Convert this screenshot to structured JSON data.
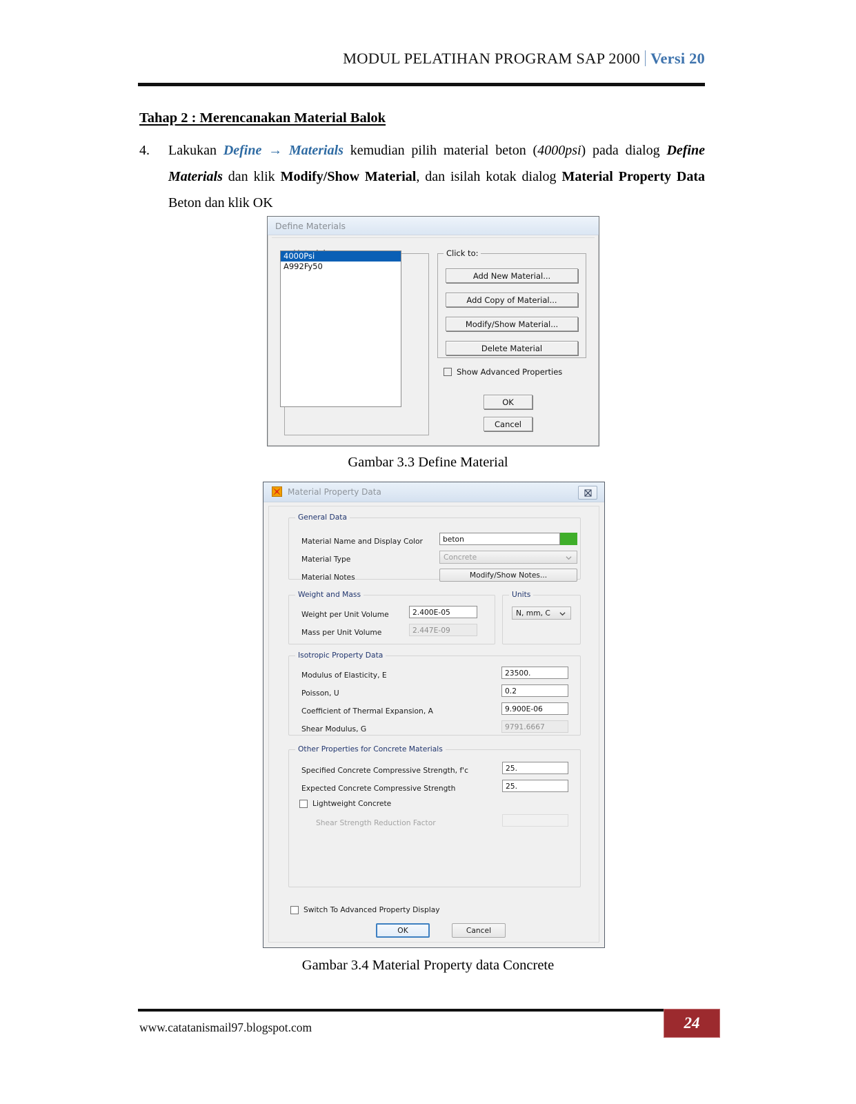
{
  "header": {
    "title": "MODUL PELATIHAN PROGRAM SAP 2000",
    "version": "Versi 20"
  },
  "body": {
    "section_heading": "Tahap 2 : Merencanakan Material Balok",
    "item_number": "4.",
    "text_1": "Lakukan ",
    "menu_path": "Define → Materials",
    "text_2": " kemudian pilih material beton (",
    "emph_1": "4000psi",
    "text_3": ") pada dialog ",
    "bold_1": "Define Materials",
    "text_4": " dan klik ",
    "bold_2": "Modify/Show Material",
    "text_5": ", dan isilah kotak dialog ",
    "bold_3": "Material Property Data",
    "text_6": " Beton dan klik OK"
  },
  "caption_1": "Gambar 3.3 Define Material",
  "caption_2": "Gambar 3.4 Material Property data Concrete",
  "dialog_define_materials": {
    "title": "Define Materials",
    "group_materials_legend": "Materials",
    "group_clickto_legend": "Click to:",
    "materials_list": [
      {
        "name": "4000Psi",
        "selected": true
      },
      {
        "name": "A992Fy50",
        "selected": false
      }
    ],
    "buttons": {
      "add_new": "Add New Material...",
      "add_copy": "Add Copy of Material...",
      "modify_show": "Modify/Show Material...",
      "delete": "Delete Material",
      "ok": "OK",
      "cancel": "Cancel"
    },
    "checkbox_show_advanced": {
      "label": "Show Advanced Properties",
      "checked": false
    }
  },
  "dialog_material_property_data": {
    "title": "Material Property Data",
    "icon": "sap2000-icon",
    "close_label": "╳",
    "general_data": {
      "legend": "General Data",
      "rows": [
        {
          "label": "Material Name and Display Color",
          "value": "beton",
          "color": "#3fae2a"
        },
        {
          "label": "Material Type",
          "value": "Concrete"
        },
        {
          "label": "Material Notes",
          "button": "Modify/Show Notes..."
        }
      ]
    },
    "weight_and_mass": {
      "legend": "Weight and Mass",
      "rows": [
        {
          "label": "Weight per Unit Volume",
          "value": "2.400E-05",
          "readonly": false
        },
        {
          "label": "Mass per Unit Volume",
          "value": "2.447E-09",
          "readonly": true
        }
      ]
    },
    "units": {
      "legend": "Units",
      "value": "N, mm, C"
    },
    "isotropic_property_data": {
      "legend": "Isotropic Property Data",
      "rows": [
        {
          "label": "Modulus of Elasticity,  E",
          "value": "23500.",
          "readonly": false
        },
        {
          "label": "Poisson, U",
          "value": "0.2",
          "readonly": false
        },
        {
          "label": "Coefficient of Thermal Expansion,  A",
          "value": "9.900E-06",
          "readonly": false
        },
        {
          "label": "Shear Modulus,  G",
          "value": "9791.6667",
          "readonly": true
        }
      ]
    },
    "other_properties_concrete": {
      "legend": "Other Properties for Concrete Materials",
      "rows": [
        {
          "label": "Specified Concrete Compressive Strength, f'c",
          "value": "25."
        },
        {
          "label": "Expected Concrete Compressive Strength",
          "value": "25."
        }
      ],
      "checkbox_lightweight": {
        "label": "Lightweight Concrete",
        "checked": false
      },
      "shear_reduction": {
        "label": "Shear Strength Reduction Factor",
        "value": "",
        "disabled": true
      }
    },
    "checkbox_switch_advanced": {
      "label": "Switch To Advanced Property Display",
      "checked": false
    },
    "buttons": {
      "ok": "OK",
      "cancel": "Cancel"
    }
  },
  "footer": {
    "url": "www.catatanismail97.blogspot.com",
    "page_number": "24"
  }
}
